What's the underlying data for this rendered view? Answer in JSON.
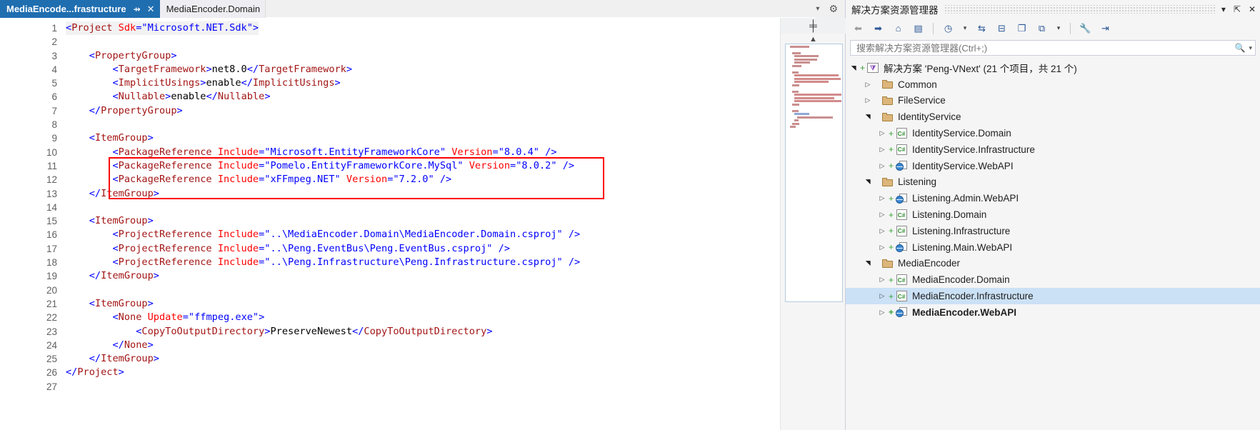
{
  "editor": {
    "tabs": [
      {
        "label": "MediaEncode...frastructure",
        "active": true,
        "pin": "⇸",
        "close": "✕"
      },
      {
        "label": "MediaEncoder.Domain",
        "active": false
      }
    ],
    "tabstrip_icons": {
      "dropdown": "▾",
      "gear": "⚙"
    },
    "line_numbers": [
      "1",
      "2",
      "3",
      "4",
      "5",
      "6",
      "7",
      "8",
      "9",
      "10",
      "11",
      "12",
      "13",
      "14",
      "15",
      "16",
      "17",
      "18",
      "19",
      "20",
      "21",
      "22",
      "23",
      "24",
      "25",
      "26",
      "27"
    ],
    "code_lines": [
      "<Project Sdk=\"Microsoft.NET.Sdk\">",
      "",
      "    <PropertyGroup>",
      "        <TargetFramework>net8.0</TargetFramework>",
      "        <ImplicitUsings>enable</ImplicitUsings>",
      "        <Nullable>enable</Nullable>",
      "    </PropertyGroup>",
      "",
      "    <ItemGroup>",
      "        <PackageReference Include=\"Microsoft.EntityFrameworkCore\" Version=\"8.0.4\" />",
      "        <PackageReference Include=\"Pomelo.EntityFrameworkCore.MySql\" Version=\"8.0.2\" />",
      "        <PackageReference Include=\"xFFmpeg.NET\" Version=\"7.2.0\" />",
      "    </ItemGroup>",
      "",
      "    <ItemGroup>",
      "        <ProjectReference Include=\"..\\MediaEncoder.Domain\\MediaEncoder.Domain.csproj\" />",
      "        <ProjectReference Include=\"..\\Peng.EventBus\\Peng.EventBus.csproj\" />",
      "        <ProjectReference Include=\"..\\Peng.Infrastructure\\Peng.Infrastructure.csproj\" />",
      "    </ItemGroup>",
      "",
      "    <ItemGroup>",
      "        <None Update=\"ffmpeg.exe\">",
      "            <CopyToOutputDirectory>PreserveNewest</CopyToOutputDirectory>",
      "        </None>",
      "    </ItemGroup>",
      "</Project>",
      ""
    ],
    "highlight_box": {
      "color": "#ff0000",
      "lines": [
        10,
        11,
        12
      ]
    },
    "scroll_icons": {
      "split": "╪",
      "caret_up": "▲"
    }
  },
  "solution_explorer": {
    "title": "解决方案资源管理器",
    "header_icons": {
      "dropdown": "▾",
      "pin": "⇱",
      "close": "✕"
    },
    "toolbar_icons": [
      {
        "name": "back-icon",
        "glyph": "⬅"
      },
      {
        "name": "forward-icon",
        "glyph": "➡"
      },
      {
        "name": "home-icon",
        "glyph": "⌂"
      },
      {
        "name": "solution-view-icon",
        "glyph": "▤"
      },
      {
        "name": "pending-changes-icon",
        "glyph": "◷"
      },
      {
        "name": "pending-changes-dropdown-icon",
        "glyph": "▾"
      },
      {
        "name": "sync-with-active-document-icon",
        "glyph": "⇆"
      },
      {
        "name": "collapse-all-icon",
        "glyph": "⊟"
      },
      {
        "name": "show-all-files-icon",
        "glyph": "❐"
      },
      {
        "name": "properties-view-icon",
        "glyph": "⧉"
      },
      {
        "name": "view-dropdown-icon",
        "glyph": "▾"
      },
      {
        "name": "properties-icon",
        "glyph": "🔧"
      },
      {
        "name": "preview-icon",
        "glyph": "⇥"
      }
    ],
    "search": {
      "placeholder": "搜索解决方案资源管理器(Ctrl+;)",
      "value": "",
      "icon": "search-icon",
      "dropdown": "▾"
    },
    "tree": [
      {
        "depth": 0,
        "label": "解决方案 'Peng-VNext' (21 个项目，共 21 个)",
        "icon": "solution",
        "arrow": "expanded",
        "plus": true,
        "selected": false,
        "bold": false
      },
      {
        "depth": 1,
        "label": "Common",
        "icon": "folder",
        "arrow": "collapsed",
        "plus": false,
        "selected": false,
        "bold": false
      },
      {
        "depth": 1,
        "label": "FileService",
        "icon": "folder",
        "arrow": "collapsed",
        "plus": false,
        "selected": false,
        "bold": false
      },
      {
        "depth": 1,
        "label": "IdentityService",
        "icon": "folder",
        "arrow": "expanded",
        "plus": false,
        "selected": false,
        "bold": false
      },
      {
        "depth": 2,
        "label": "IdentityService.Domain",
        "icon": "csharp",
        "arrow": "collapsed",
        "plus": true,
        "selected": false,
        "bold": false
      },
      {
        "depth": 2,
        "label": "IdentityService.Infrastructure",
        "icon": "csharp",
        "arrow": "collapsed",
        "plus": true,
        "selected": false,
        "bold": false
      },
      {
        "depth": 2,
        "label": "IdentityService.WebAPI",
        "icon": "webapi",
        "arrow": "collapsed",
        "plus": true,
        "selected": false,
        "bold": false
      },
      {
        "depth": 1,
        "label": "Listening",
        "icon": "folder",
        "arrow": "expanded",
        "plus": false,
        "selected": false,
        "bold": false
      },
      {
        "depth": 2,
        "label": "Listening.Admin.WebAPI",
        "icon": "webapi",
        "arrow": "collapsed",
        "plus": true,
        "selected": false,
        "bold": false
      },
      {
        "depth": 2,
        "label": "Listening.Domain",
        "icon": "csharp",
        "arrow": "collapsed",
        "plus": true,
        "selected": false,
        "bold": false
      },
      {
        "depth": 2,
        "label": "Listening.Infrastructure",
        "icon": "csharp",
        "arrow": "collapsed",
        "plus": true,
        "selected": false,
        "bold": false
      },
      {
        "depth": 2,
        "label": "Listening.Main.WebAPI",
        "icon": "webapi",
        "arrow": "collapsed",
        "plus": true,
        "selected": false,
        "bold": false
      },
      {
        "depth": 1,
        "label": "MediaEncoder",
        "icon": "folder",
        "arrow": "expanded",
        "plus": false,
        "selected": false,
        "bold": false
      },
      {
        "depth": 2,
        "label": "MediaEncoder.Domain",
        "icon": "csharp",
        "arrow": "collapsed",
        "plus": true,
        "selected": false,
        "bold": false
      },
      {
        "depth": 2,
        "label": "MediaEncoder.Infrastructure",
        "icon": "csharp",
        "arrow": "collapsed",
        "plus": true,
        "selected": true,
        "bold": false
      },
      {
        "depth": 2,
        "label": "MediaEncoder.WebAPI",
        "icon": "webapi",
        "arrow": "collapsed",
        "plus": true,
        "selected": false,
        "bold": true
      }
    ]
  },
  "colors": {
    "tab_active_bg": "#1f6eb0",
    "xml_element": "#a31515",
    "xml_attribute": "#ff0000",
    "xml_value": "#0000ff",
    "highlight_border": "#ff0000",
    "tree_selection": "#cbe1f5"
  }
}
